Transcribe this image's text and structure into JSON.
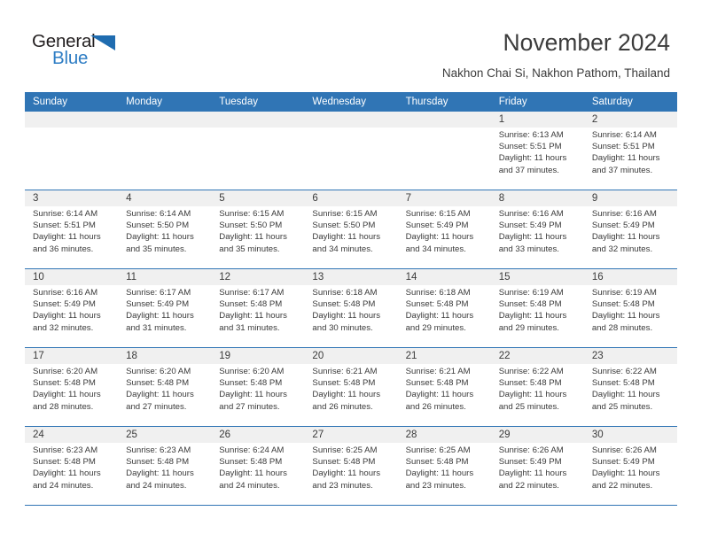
{
  "branding": {
    "logo_primary": "General",
    "logo_secondary": "Blue",
    "flag_icon": "flag-triangle-icon",
    "accent_color": "#2e7dc4"
  },
  "header": {
    "title": "November 2024",
    "subtitle": "Nakhon Chai Si, Nakhon Pathom, Thailand"
  },
  "calendar": {
    "header_color": "#3075b5",
    "date_band_color": "#f0f0f0",
    "weekday_headers": [
      "Sunday",
      "Monday",
      "Tuesday",
      "Wednesday",
      "Thursday",
      "Friday",
      "Saturday"
    ],
    "weeks": [
      {
        "dates": [
          "",
          "",
          "",
          "",
          "",
          "1",
          "2"
        ],
        "cells": [
          {
            "sunrise": "",
            "sunset": "",
            "daylight_1": "",
            "daylight_2": ""
          },
          {
            "sunrise": "",
            "sunset": "",
            "daylight_1": "",
            "daylight_2": ""
          },
          {
            "sunrise": "",
            "sunset": "",
            "daylight_1": "",
            "daylight_2": ""
          },
          {
            "sunrise": "",
            "sunset": "",
            "daylight_1": "",
            "daylight_2": ""
          },
          {
            "sunrise": "",
            "sunset": "",
            "daylight_1": "",
            "daylight_2": ""
          },
          {
            "sunrise": "Sunrise: 6:13 AM",
            "sunset": "Sunset: 5:51 PM",
            "daylight_1": "Daylight: 11 hours",
            "daylight_2": "and 37 minutes."
          },
          {
            "sunrise": "Sunrise: 6:14 AM",
            "sunset": "Sunset: 5:51 PM",
            "daylight_1": "Daylight: 11 hours",
            "daylight_2": "and 37 minutes."
          }
        ]
      },
      {
        "dates": [
          "3",
          "4",
          "5",
          "6",
          "7",
          "8",
          "9"
        ],
        "cells": [
          {
            "sunrise": "Sunrise: 6:14 AM",
            "sunset": "Sunset: 5:51 PM",
            "daylight_1": "Daylight: 11 hours",
            "daylight_2": "and 36 minutes."
          },
          {
            "sunrise": "Sunrise: 6:14 AM",
            "sunset": "Sunset: 5:50 PM",
            "daylight_1": "Daylight: 11 hours",
            "daylight_2": "and 35 minutes."
          },
          {
            "sunrise": "Sunrise: 6:15 AM",
            "sunset": "Sunset: 5:50 PM",
            "daylight_1": "Daylight: 11 hours",
            "daylight_2": "and 35 minutes."
          },
          {
            "sunrise": "Sunrise: 6:15 AM",
            "sunset": "Sunset: 5:50 PM",
            "daylight_1": "Daylight: 11 hours",
            "daylight_2": "and 34 minutes."
          },
          {
            "sunrise": "Sunrise: 6:15 AM",
            "sunset": "Sunset: 5:49 PM",
            "daylight_1": "Daylight: 11 hours",
            "daylight_2": "and 34 minutes."
          },
          {
            "sunrise": "Sunrise: 6:16 AM",
            "sunset": "Sunset: 5:49 PM",
            "daylight_1": "Daylight: 11 hours",
            "daylight_2": "and 33 minutes."
          },
          {
            "sunrise": "Sunrise: 6:16 AM",
            "sunset": "Sunset: 5:49 PM",
            "daylight_1": "Daylight: 11 hours",
            "daylight_2": "and 32 minutes."
          }
        ]
      },
      {
        "dates": [
          "10",
          "11",
          "12",
          "13",
          "14",
          "15",
          "16"
        ],
        "cells": [
          {
            "sunrise": "Sunrise: 6:16 AM",
            "sunset": "Sunset: 5:49 PM",
            "daylight_1": "Daylight: 11 hours",
            "daylight_2": "and 32 minutes."
          },
          {
            "sunrise": "Sunrise: 6:17 AM",
            "sunset": "Sunset: 5:49 PM",
            "daylight_1": "Daylight: 11 hours",
            "daylight_2": "and 31 minutes."
          },
          {
            "sunrise": "Sunrise: 6:17 AM",
            "sunset": "Sunset: 5:48 PM",
            "daylight_1": "Daylight: 11 hours",
            "daylight_2": "and 31 minutes."
          },
          {
            "sunrise": "Sunrise: 6:18 AM",
            "sunset": "Sunset: 5:48 PM",
            "daylight_1": "Daylight: 11 hours",
            "daylight_2": "and 30 minutes."
          },
          {
            "sunrise": "Sunrise: 6:18 AM",
            "sunset": "Sunset: 5:48 PM",
            "daylight_1": "Daylight: 11 hours",
            "daylight_2": "and 29 minutes."
          },
          {
            "sunrise": "Sunrise: 6:19 AM",
            "sunset": "Sunset: 5:48 PM",
            "daylight_1": "Daylight: 11 hours",
            "daylight_2": "and 29 minutes."
          },
          {
            "sunrise": "Sunrise: 6:19 AM",
            "sunset": "Sunset: 5:48 PM",
            "daylight_1": "Daylight: 11 hours",
            "daylight_2": "and 28 minutes."
          }
        ]
      },
      {
        "dates": [
          "17",
          "18",
          "19",
          "20",
          "21",
          "22",
          "23"
        ],
        "cells": [
          {
            "sunrise": "Sunrise: 6:20 AM",
            "sunset": "Sunset: 5:48 PM",
            "daylight_1": "Daylight: 11 hours",
            "daylight_2": "and 28 minutes."
          },
          {
            "sunrise": "Sunrise: 6:20 AM",
            "sunset": "Sunset: 5:48 PM",
            "daylight_1": "Daylight: 11 hours",
            "daylight_2": "and 27 minutes."
          },
          {
            "sunrise": "Sunrise: 6:20 AM",
            "sunset": "Sunset: 5:48 PM",
            "daylight_1": "Daylight: 11 hours",
            "daylight_2": "and 27 minutes."
          },
          {
            "sunrise": "Sunrise: 6:21 AM",
            "sunset": "Sunset: 5:48 PM",
            "daylight_1": "Daylight: 11 hours",
            "daylight_2": "and 26 minutes."
          },
          {
            "sunrise": "Sunrise: 6:21 AM",
            "sunset": "Sunset: 5:48 PM",
            "daylight_1": "Daylight: 11 hours",
            "daylight_2": "and 26 minutes."
          },
          {
            "sunrise": "Sunrise: 6:22 AM",
            "sunset": "Sunset: 5:48 PM",
            "daylight_1": "Daylight: 11 hours",
            "daylight_2": "and 25 minutes."
          },
          {
            "sunrise": "Sunrise: 6:22 AM",
            "sunset": "Sunset: 5:48 PM",
            "daylight_1": "Daylight: 11 hours",
            "daylight_2": "and 25 minutes."
          }
        ]
      },
      {
        "dates": [
          "24",
          "25",
          "26",
          "27",
          "28",
          "29",
          "30"
        ],
        "cells": [
          {
            "sunrise": "Sunrise: 6:23 AM",
            "sunset": "Sunset: 5:48 PM",
            "daylight_1": "Daylight: 11 hours",
            "daylight_2": "and 24 minutes."
          },
          {
            "sunrise": "Sunrise: 6:23 AM",
            "sunset": "Sunset: 5:48 PM",
            "daylight_1": "Daylight: 11 hours",
            "daylight_2": "and 24 minutes."
          },
          {
            "sunrise": "Sunrise: 6:24 AM",
            "sunset": "Sunset: 5:48 PM",
            "daylight_1": "Daylight: 11 hours",
            "daylight_2": "and 24 minutes."
          },
          {
            "sunrise": "Sunrise: 6:25 AM",
            "sunset": "Sunset: 5:48 PM",
            "daylight_1": "Daylight: 11 hours",
            "daylight_2": "and 23 minutes."
          },
          {
            "sunrise": "Sunrise: 6:25 AM",
            "sunset": "Sunset: 5:48 PM",
            "daylight_1": "Daylight: 11 hours",
            "daylight_2": "and 23 minutes."
          },
          {
            "sunrise": "Sunrise: 6:26 AM",
            "sunset": "Sunset: 5:49 PM",
            "daylight_1": "Daylight: 11 hours",
            "daylight_2": "and 22 minutes."
          },
          {
            "sunrise": "Sunrise: 6:26 AM",
            "sunset": "Sunset: 5:49 PM",
            "daylight_1": "Daylight: 11 hours",
            "daylight_2": "and 22 minutes."
          }
        ]
      }
    ]
  }
}
